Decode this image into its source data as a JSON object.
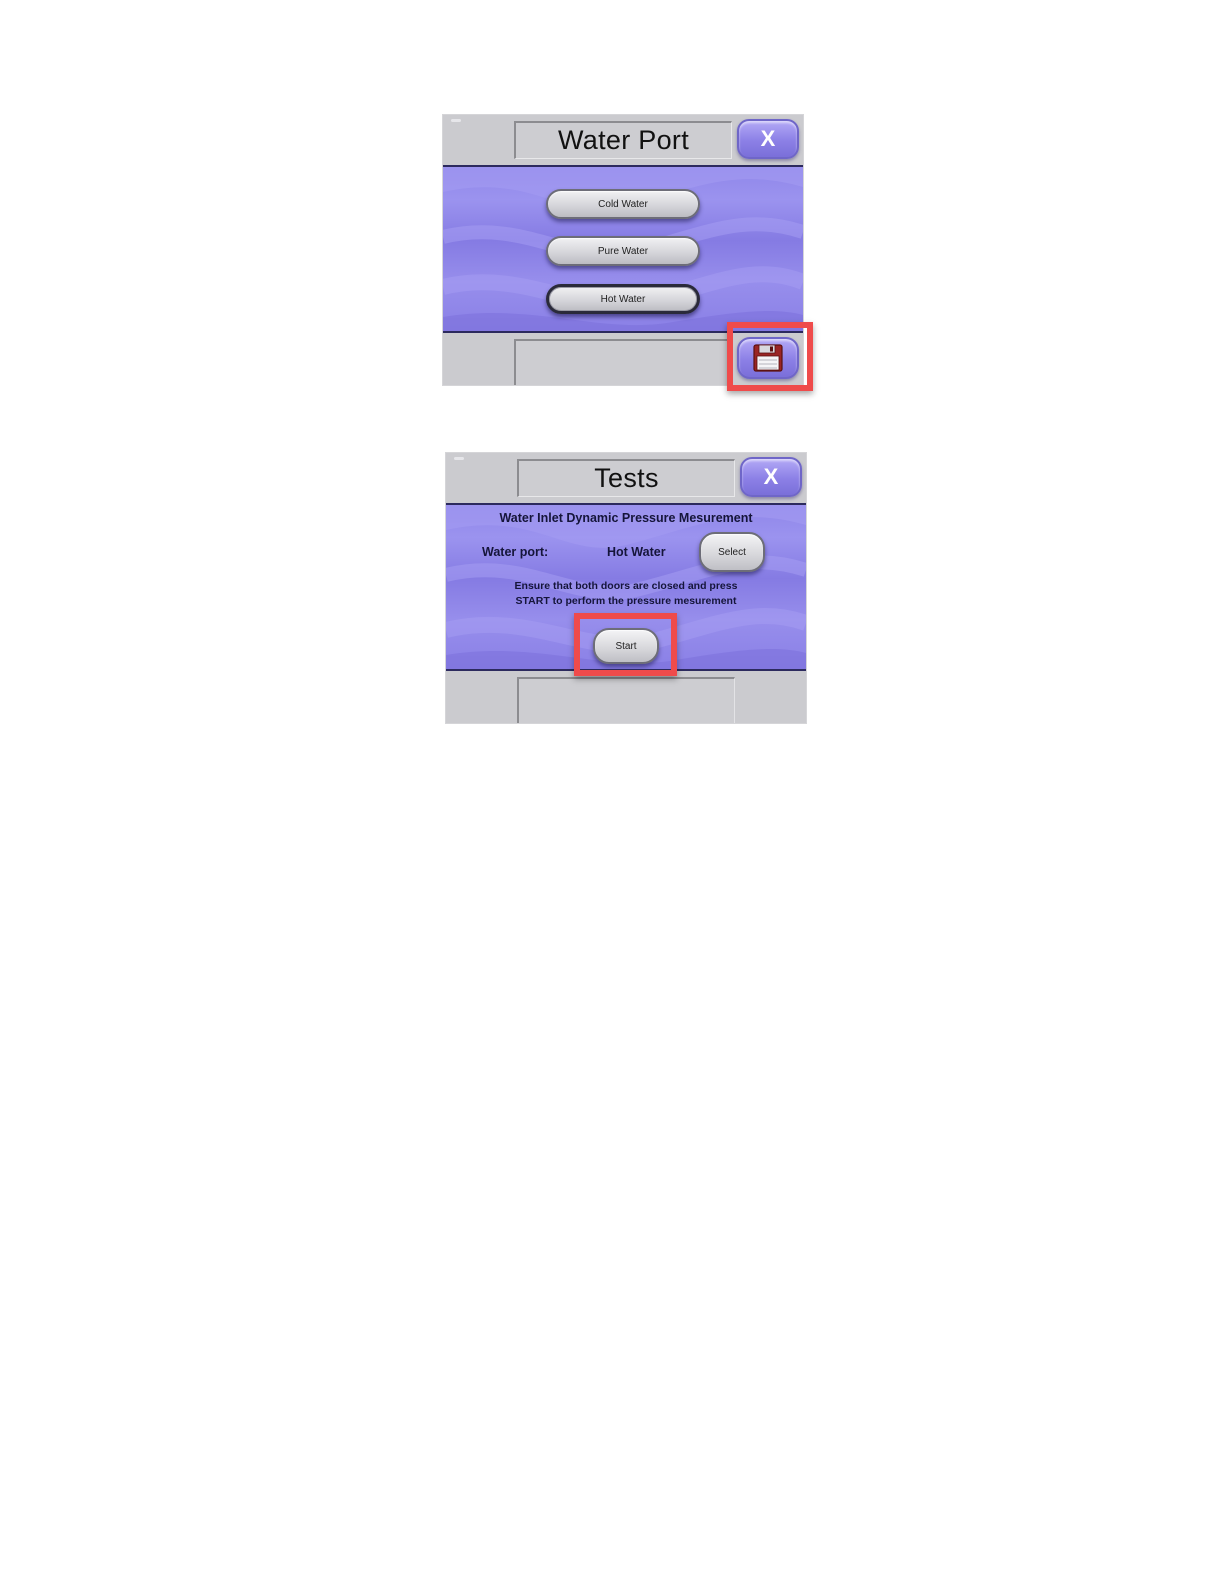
{
  "screen1": {
    "title": "Water Port",
    "close_label": "X",
    "buttons": [
      {
        "label": "Cold Water"
      },
      {
        "label": "Pure Water"
      },
      {
        "label": "Hot Water"
      }
    ],
    "selected_button": "Hot Water",
    "save_icon": "floppy-disk-icon"
  },
  "screen2": {
    "title": "Tests",
    "close_label": "X",
    "heading": "Water Inlet Dynamic Pressure Mesurement",
    "water_port_label": "Water port:",
    "water_port_value": "Hot Water",
    "select_label": "Select",
    "instructions_line1": "Ensure that both doors are closed and press",
    "instructions_line2": "START to perform the pressure mesurement",
    "start_label": "Start"
  },
  "colors": {
    "panel": "#8f86e9",
    "accent_button": "#8c80e6",
    "highlight": "#ef4b4b",
    "frame": "#cbcbcf"
  }
}
